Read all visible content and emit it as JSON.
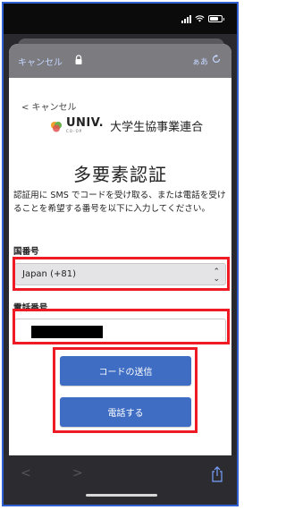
{
  "browser": {
    "cancel_label": "キャンセル",
    "text_size_label": "ぁあ"
  },
  "page": {
    "back_label": "< キャンセル",
    "logo_univ": "UNIV.",
    "logo_coop": "CO-OP",
    "logo_name": "大学生協事業連合",
    "title": "多要素認証",
    "description": "認証用に SMS でコードを受け取る、または電話を受けることを希望する番号を以下に入力してください。"
  },
  "country_code": {
    "label": "国番号",
    "value": "Japan (+81)"
  },
  "phone_number": {
    "label": "電話番号",
    "value": ""
  },
  "buttons": {
    "send_code": "コードの送信",
    "call": "電話する"
  },
  "colors": {
    "accent_button": "#3f6dc3",
    "highlight": "#ee1b24",
    "frame": "#2f5fd0"
  }
}
